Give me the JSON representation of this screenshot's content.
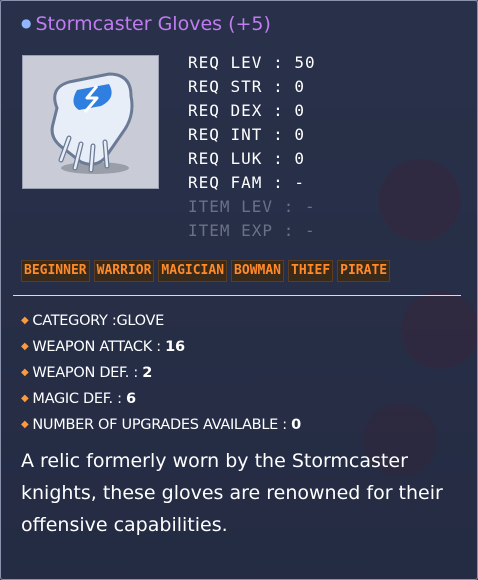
{
  "item": {
    "name": "Stormcaster Gloves (+5)",
    "icon": "glove-icon"
  },
  "requirements": [
    {
      "text": "REQ LEV : 50"
    },
    {
      "text": "REQ STR : 0"
    },
    {
      "text": "REQ DEX : 0"
    },
    {
      "text": "REQ INT : 0"
    },
    {
      "text": "REQ LUK : 0"
    },
    {
      "text": "REQ FAM : -"
    },
    {
      "text": "ITEM LEV : -"
    },
    {
      "text": "ITEM EXP : -"
    }
  ],
  "classes": [
    "BEGINNER",
    "WARRIOR",
    "MAGICIAN",
    "BOWMAN",
    "THIEF",
    "PIRATE"
  ],
  "stats": [
    {
      "label": "CATEGORY :",
      "value": "GLOVE"
    },
    {
      "label": "WEAPON ATTACK : ",
      "value": "16"
    },
    {
      "label": "WEAPON DEF. : ",
      "value": "2"
    },
    {
      "label": "MAGIC DEF. : ",
      "value": "6"
    },
    {
      "label": "NUMBER OF UPGRADES AVAILABLE : ",
      "value": "0"
    }
  ],
  "description": "A relic formerly worn by the Stormcaster knights, these gloves are renowned for their offensive capabilities.",
  "colors": {
    "title": "#c07cf0",
    "class_text": "#ff8a2a",
    "disabled_text": "#6a7088"
  }
}
